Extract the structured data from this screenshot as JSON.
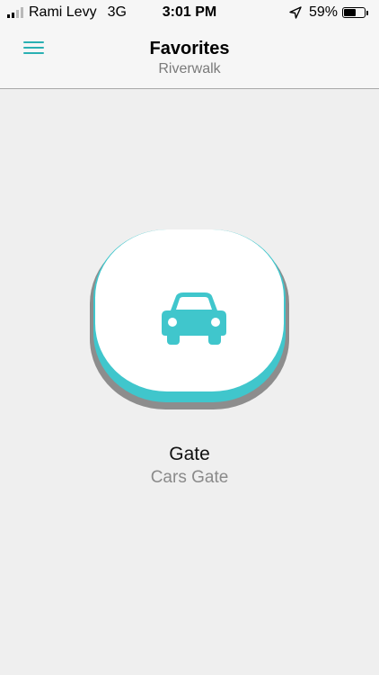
{
  "status_bar": {
    "carrier": "Rami Levy",
    "network": "3G",
    "time": "3:01 PM",
    "battery_percent": "59%",
    "battery_level": 0.59,
    "signal_bars_active": 2,
    "icons": [
      "signal-bars-icon",
      "location-arrow-icon",
      "battery-icon"
    ]
  },
  "nav": {
    "title": "Favorites",
    "subtitle": "Riverwalk",
    "menu_icon": "hamburger-menu-icon"
  },
  "favorites": [
    {
      "icon": "car-icon",
      "label": "Gate",
      "sublabel": "Cars Gate"
    }
  ],
  "colors": {
    "accent": "#2ab0b3",
    "tile_edge": "#40c6cc",
    "background": "#efefef",
    "subtitle_gray": "#7a7a7a"
  }
}
